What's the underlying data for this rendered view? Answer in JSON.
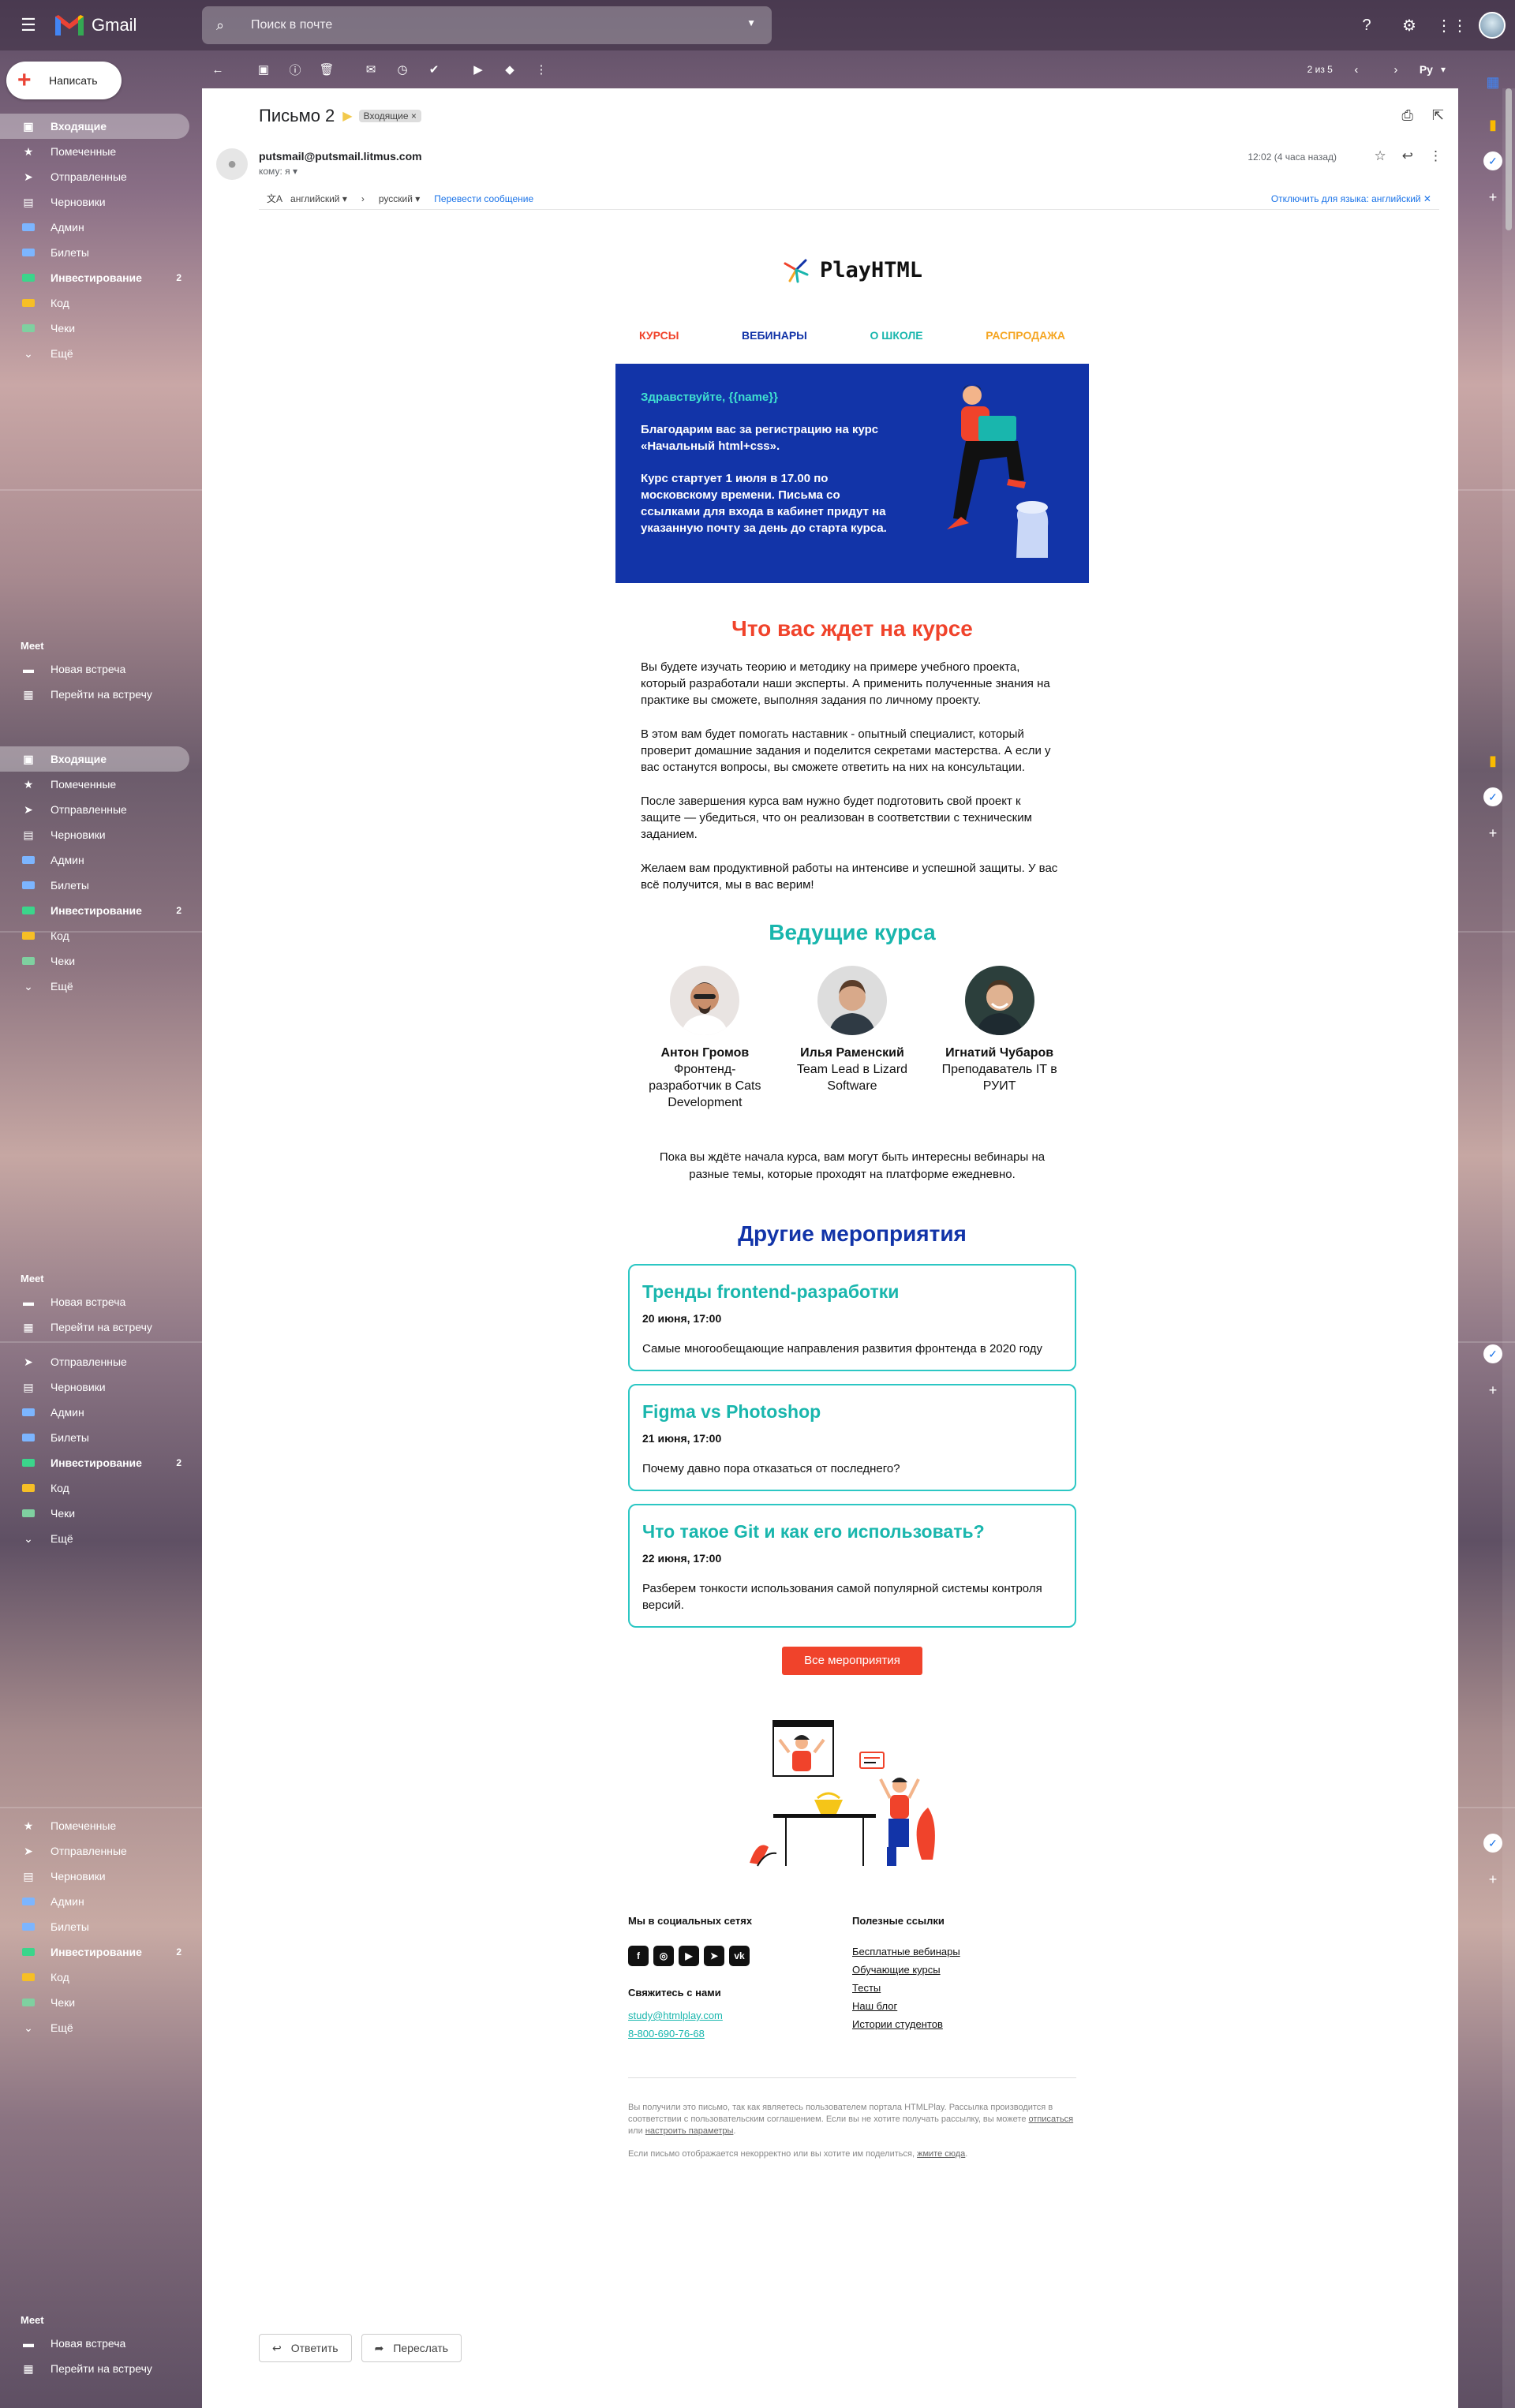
{
  "app": {
    "name": "Gmail"
  },
  "search": {
    "placeholder": "Поиск в почте"
  },
  "compose": {
    "label": "Написать"
  },
  "sidebar": {
    "items": [
      {
        "label": "Входящие",
        "icon": "inbox-icon",
        "active": true
      },
      {
        "label": "Помеченные",
        "icon": "star-icon"
      },
      {
        "label": "Отправленные",
        "icon": "send-icon"
      },
      {
        "label": "Черновики",
        "icon": "draft-icon"
      },
      {
        "label": "Админ",
        "icon": "label-icon",
        "color": "#7cb5ff"
      },
      {
        "label": "Билеты",
        "icon": "label-icon",
        "color": "#7cb5ff"
      },
      {
        "label": "Инвестирование",
        "icon": "label-icon",
        "color": "#3bd58b",
        "count": "2",
        "bold": true
      },
      {
        "label": "Код",
        "icon": "label-icon",
        "color": "#f6bf26"
      },
      {
        "label": "Чеки",
        "icon": "label-icon",
        "color": "#7fd0a0"
      },
      {
        "label": "Ещё",
        "icon": "chevron-down-icon"
      }
    ],
    "meet": {
      "title": "Meet",
      "new_meeting": "Новая встреча",
      "join": "Перейти на встречу"
    }
  },
  "toolbar": {
    "pager": "2 из 5",
    "lang": "Ру"
  },
  "message": {
    "subject": "Письмо 2",
    "tag": "Входящие ×",
    "from": "putsmail@putsmail.litmus.com",
    "to": "кому: я ▾",
    "time": "12:02 (4 часа назад)",
    "translate": {
      "from_lang": "английский ▾",
      "to_lang": "русский ▾",
      "action": "Перевести сообщение",
      "disable": "Отключить для языка: английский ✕"
    }
  },
  "email": {
    "brand": "PlayHTML",
    "nav": [
      {
        "label": "КУРСЫ",
        "color": "#f0432b"
      },
      {
        "label": "ВЕБИНАРЫ",
        "color": "#1234a8"
      },
      {
        "label": "О ШКОЛЕ",
        "color": "#19b6ad"
      },
      {
        "label": "РАСПРОДАЖА",
        "color": "#f5a623"
      }
    ],
    "hero": {
      "greeting": "Здравствуйте, {{name}}",
      "p1": "Благодарим вас за регистрацию на курс «Начальный html+css».",
      "p2": "Курс стартует 1 июля в 17.00 по московскому времени. Письма со ссылками для входа в кабинет придут на указанную почту за день до старта курса."
    },
    "what_title": "Что вас ждет на курсе",
    "what_paragraphs": [
      "Вы будете изучать теорию и методику на примере учебного проекта, который разработали наши эксперты. А применить полученные знания на практике вы сможете, выполняя задания по личному проекту.",
      "В этом вам будет помогать наставник - опытный специалист, который проверит домашние задания и поделится секретами мастерства. А если у вас останутся вопросы, вы сможете ответить на них на консультации.",
      "После завершения курса вам нужно будет подготовить свой проект к защите — убедиться, что он реализован в соответствии с техническим заданием.",
      "Желаем вам продуктивной работы на интенсиве и успешной защиты. У вас всё получится, мы в вас верим!"
    ],
    "teachers_title": "Ведущие курса",
    "teachers": [
      {
        "name": "Антон Громов",
        "role": "Фронтенд-разработчик в Cats Development"
      },
      {
        "name": "Илья Раменский",
        "role": "Team Lead в Lizard Software"
      },
      {
        "name": "Игнатий Чубаров",
        "role": "Преподаватель IT в РУИТ"
      }
    ],
    "intro2": "Пока вы ждёте начала курса, вам могут быть интересны вебинары на разные темы, которые проходят на платформе ежедневно.",
    "events_title": "Другие мероприятия",
    "events": [
      {
        "title": "Тренды frontend-разработки",
        "date": "20 июня, 17:00",
        "desc": "Самые многообещающие направления развития фронтенда в 2020 году"
      },
      {
        "title": "Figma vs Photoshop",
        "date": "21 июня, 17:00",
        "desc": "Почему давно пора отказаться от последнего?"
      },
      {
        "title": "Что такое Git и как его использовать?",
        "date": "22 июня, 17:00",
        "desc": "Разберем тонкости использования самой популярной системы контроля версий."
      }
    ],
    "cta": "Все мероприятия",
    "footer": {
      "social_title": "Мы в социальных сетях",
      "social": [
        "f",
        "◎",
        "▶",
        "➤",
        "vk"
      ],
      "contact_title": "Свяжитесь с нами",
      "email": "study@htmlplay.com",
      "phone": "8-800-690-76-68",
      "links_title": "Полезные ссылки",
      "links": [
        "Бесплатные вебинары",
        "Обучающие курсы",
        "Тесты",
        "Наш блог",
        "Истории студентов"
      ],
      "fine1a": "Вы получили это письмо, так как являетесь пользователем портала HTMLPlay. Рассылка производится в соответствии с пользовательским соглашением. Если вы не хотите получать рассылку, вы можете",
      "fine1_unsub": "отписаться",
      "fine1_or": "или",
      "fine1_settings": "настроить параметры",
      "fine2": "Если письмо отображается некорректно или вы хотите им поделиться,",
      "fine2_link": "жмите сюда"
    }
  },
  "reply": {
    "reply": "Ответить",
    "forward": "Переслать"
  }
}
